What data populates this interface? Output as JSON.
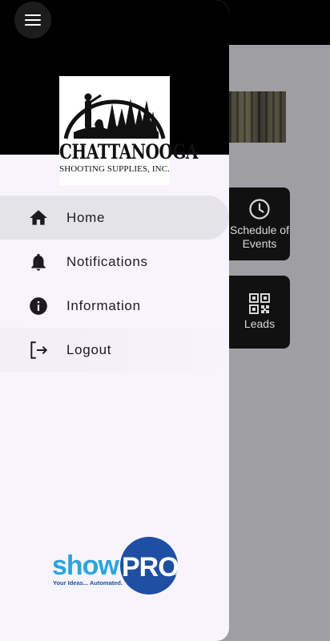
{
  "app_bar": {
    "title": "Chattanooga",
    "menu_icon": "hamburger-icon"
  },
  "background": {
    "tiles": [
      {
        "label": "Schedule of Events",
        "line1": "Schedule of",
        "line2": "Events",
        "icon": "clock-icon"
      },
      {
        "label": "Leads",
        "icon": "qr-code-icon"
      }
    ]
  },
  "drawer": {
    "logo": {
      "line1": "CHATTANOOGA",
      "line2": "SHOOTING SUPPLIES, INC."
    },
    "items": [
      {
        "label": "Home",
        "icon": "home-icon",
        "active": true
      },
      {
        "label": "Notifications",
        "icon": "bell-icon"
      },
      {
        "label": "Information",
        "icon": "info-icon"
      },
      {
        "label": "Logout",
        "icon": "logout-icon"
      }
    ],
    "footer_logo": {
      "text1": "show",
      "text2": "PRO",
      "tagline": "Your Ideas... Automated.",
      "mark": "SM"
    }
  },
  "colors": {
    "drawer_bg": "#f7f4fb",
    "active_item": "#e4e3e8",
    "scrim": "#9e9ea3",
    "brand_blue": "#1e4fa3",
    "brand_light_blue": "#2ba5dd"
  }
}
